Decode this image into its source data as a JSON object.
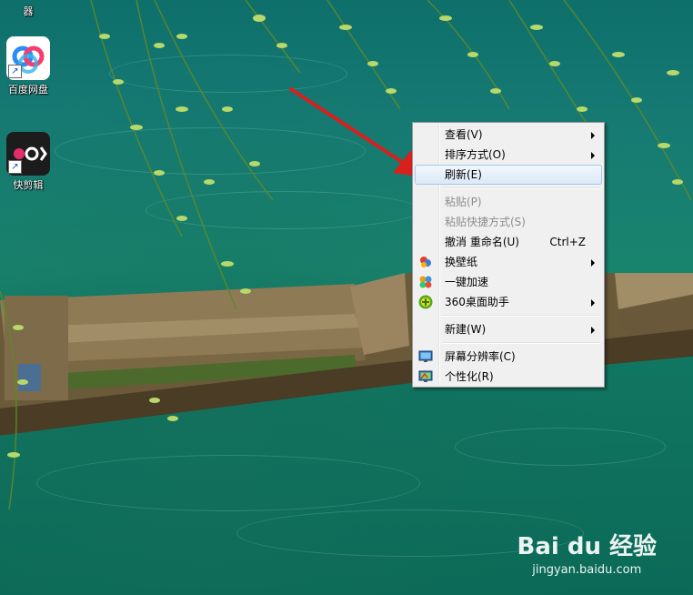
{
  "desktop": {
    "icons": [
      {
        "label": "百度网盘",
        "icon": "baidu-netdisk-icon"
      },
      {
        "label": "快剪辑",
        "icon": "kuaijianji-icon"
      }
    ],
    "top_label_fragment": "器"
  },
  "context_menu": {
    "items": [
      {
        "label": "查看(V)",
        "submenu": true
      },
      {
        "label": "排序方式(O)",
        "submenu": true
      },
      {
        "label": "刷新(E)",
        "highlighted": true
      },
      {
        "label": "粘贴(P)",
        "disabled": true
      },
      {
        "label": "粘贴快捷方式(S)",
        "disabled": true
      },
      {
        "label": "撤消 重命名(U)",
        "shortcut": "Ctrl+Z"
      },
      {
        "label": "换壁纸",
        "icon": "wallpaper-icon",
        "submenu": true
      },
      {
        "label": "一键加速",
        "icon": "speedup-icon"
      },
      {
        "label": "360桌面助手",
        "icon": "360-assistant-icon",
        "submenu": true
      },
      {
        "label": "新建(W)",
        "submenu": true
      },
      {
        "label": "屏幕分辨率(C)",
        "icon": "screen-resolution-icon"
      },
      {
        "label": "个性化(R)",
        "icon": "personalize-icon"
      }
    ]
  },
  "watermark": {
    "brand": "Bai du 经验",
    "url": "jingyan.baidu.com"
  },
  "colors": {
    "menu_bg": "#f0f0f0",
    "highlight_border": "#a8c8eb",
    "arrow_red": "#d8201e"
  }
}
